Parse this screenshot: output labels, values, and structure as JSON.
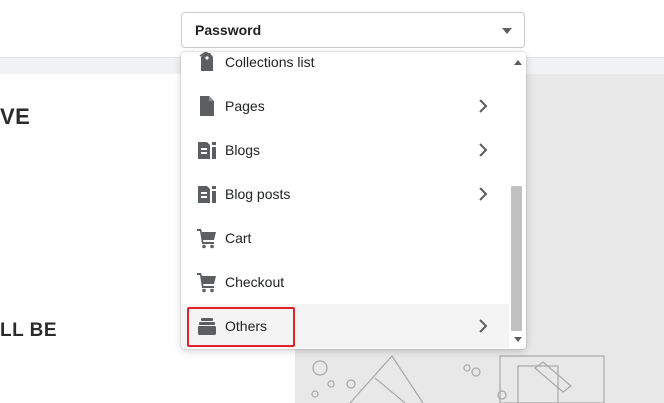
{
  "select": {
    "value": "Password"
  },
  "preview": {
    "heading_1": "VE",
    "heading_2": "LL BE"
  },
  "menu": {
    "items": [
      {
        "label": "Collections list",
        "icon": "tag-icon",
        "submenu": false
      },
      {
        "label": "Pages",
        "icon": "page-icon",
        "submenu": true
      },
      {
        "label": "Blogs",
        "icon": "blog-icon",
        "submenu": true
      },
      {
        "label": "Blog posts",
        "icon": "blog-icon",
        "submenu": true
      },
      {
        "label": "Cart",
        "icon": "cart-icon",
        "submenu": false
      },
      {
        "label": "Checkout",
        "icon": "cart-icon",
        "submenu": false
      },
      {
        "label": "Others",
        "icon": "others-icon",
        "submenu": true,
        "highlighted": true
      }
    ]
  },
  "colors": {
    "highlight_border": "#e0222d",
    "icon": "#5c5f62",
    "hover_row": "#f4f4f5"
  }
}
